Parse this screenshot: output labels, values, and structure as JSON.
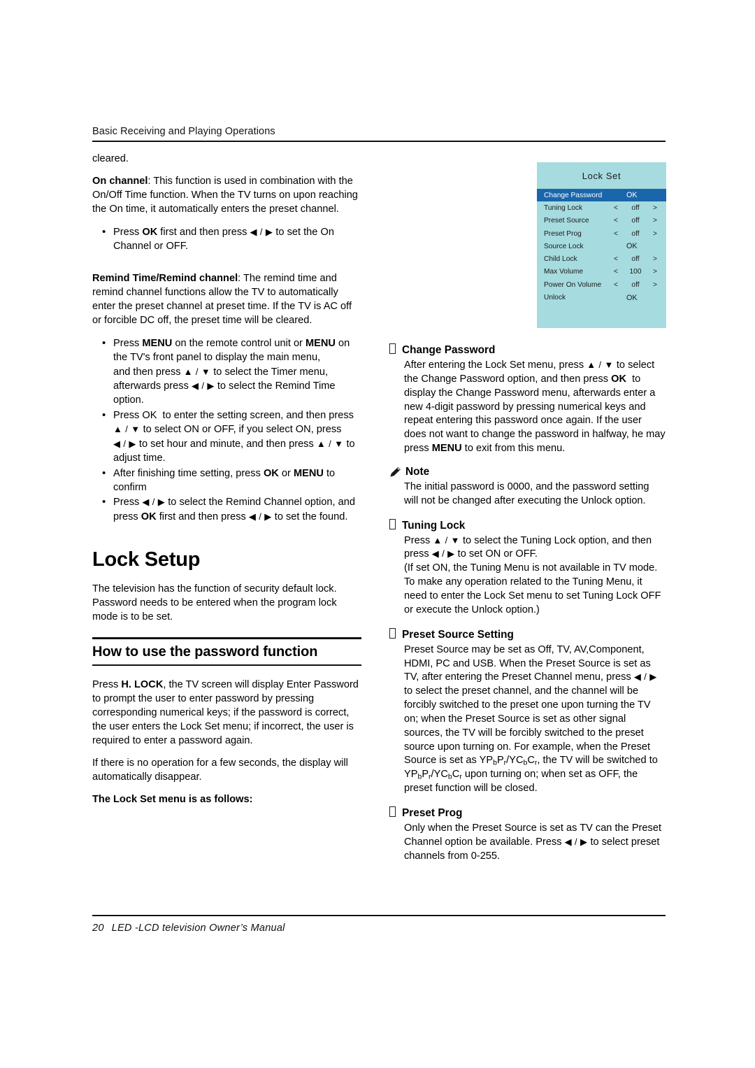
{
  "header": {
    "running_title": "Basic Receiving and Playing Operations"
  },
  "left_column": {
    "cleared_text": "cleared.",
    "on_channel": {
      "label": "On channel",
      "text": ":  This function is used in combination with the On/Off Time function. When the TV turns on upon reaching the On time, it automatically enters the preset channel.",
      "bullet": "Press OK first and then press ◀ / ▶ to set the On Channel or OFF."
    },
    "remind": {
      "label": "Remind Time/Remind channel",
      "text": ":  The remind time and remind channel functions allow the TV to automatically enter the preset channel at preset time. If the TV is AC off or forcible DC off, the preset time will be cleared.",
      "bullets": [
        "Press MENU on the remote control unit or MENU on the TV's front panel to display the main menu, and then press ▲ / ▼ to select the Timer menu, afterwards press ◀ / ▶ to select the Remind Time option.",
        "Press OK  to enter the setting screen, and then press ▲ / ▼ to select ON or OFF, if you select ON, press ◀ / ▶ to set hour and minute, and then press ▲ / ▼ to adjust time.",
        "After finishing time setting, press OK or MENU to confirm",
        "Press ◀ / ▶ to select the Remind Channel option, and press OK first and then press ◀ / ▶ to set the found."
      ]
    },
    "chapter_title": "Lock Setup",
    "chapter_intro": "The television has the function of security default lock. Password needs to be entered when the program lock mode is to be set.",
    "subhead": "How to use the password function",
    "password_para_1": "Press H. LOCK, the TV screen will display Enter Password to prompt the user to enter password by pressing corresponding numerical keys; if the password is correct, the user enters the Lock Set menu; if incorrect, the user is required to enter a password again.",
    "password_para_2": "If there is no operation for a few seconds, the display will automatically disappear.",
    "menu_lead_in": "The Lock Set menu is as follows:"
  },
  "osd": {
    "title": "Lock  Set",
    "left_arrow": "<",
    "right_arrow": ">",
    "colors": {
      "panel_background": "#a6dbdf",
      "selected_row": "#1a66ab",
      "selected_text": "#ffffff",
      "text": "#1a1a1a"
    },
    "rows": [
      {
        "label": "Change Password",
        "type": "ok",
        "value": "OK",
        "selected": true
      },
      {
        "label": "Tuning Lock",
        "type": "adjust",
        "value": "off",
        "selected": false
      },
      {
        "label": "Preset Source",
        "type": "adjust",
        "value": "off",
        "selected": false
      },
      {
        "label": "Preset Prog",
        "type": "adjust",
        "value": "off",
        "selected": false
      },
      {
        "label": "Source Lock",
        "type": "ok",
        "value": "OK",
        "selected": false
      },
      {
        "label": "Child Lock",
        "type": "adjust",
        "value": "off",
        "selected": false
      },
      {
        "label": "Max Volume",
        "type": "adjust",
        "value": "100",
        "selected": false
      },
      {
        "label": "Power On Volume",
        "type": "adjust",
        "value": "off",
        "selected": false
      },
      {
        "label": "Unlock",
        "type": "ok",
        "value": "OK",
        "selected": false
      }
    ]
  },
  "right_column": {
    "change_password": {
      "heading": "Change Password",
      "body": "After entering the Lock Set menu, press ▲ / ▼ to select the Change Password option, and then press OK  to display the Change Password menu, afterwards enter a new 4-digit password by pressing numerical keys and repeat entering this password once again. If the user does not want to change the password in halfway, he may press MENU to exit from this menu."
    },
    "note": {
      "heading": "Note",
      "body": "The initial password is 0000, and the password setting will not be changed after executing the Unlock option."
    },
    "tuning_lock": {
      "heading": "Tuning Lock",
      "body": "Press ▲ / ▼ to select the Tuning Lock option, and then press ◀ / ▶ to set ON or OFF. (If set ON, the Tuning Menu is not available in TV mode. To make any operation related to the Tuning Menu, it need to enter the Lock Set menu to set Tuning Lock OFF or execute the Unlock option.)"
    },
    "preset_source": {
      "heading": "Preset Source Setting",
      "body_part1": "Preset Source may be set as Off, TV, AV,Component, HDMI, PC and USB. When the Preset Source is set as TV, after entering the Preset Channel menu, press",
      "body_part2": "to select the preset channel, and the channel will be forcibly switched to the preset one upon turning the TV on; when the Preset Source is set as other signal sources, the TV will be forcibly switched to the preset source upon turning on. For example, when the Preset Source is set as",
      "body_part3": ", the TV will be switched to",
      "body_part4": "upon turning on; when set as OFF, the preset function will be closed.",
      "component_label": "YPbPr/YCbCr"
    },
    "preset_prog": {
      "heading": "Preset Prog",
      "body": "Only when the Preset Source is set as TV can the Preset Channel option be available. Press ◀ / ▶ to select preset channels from 0-255."
    }
  },
  "footer": {
    "page_number": "20",
    "text": "LED -LCD  television  Owner’s Manual"
  }
}
